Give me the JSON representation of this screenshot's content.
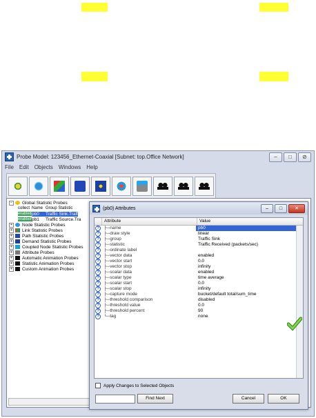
{
  "main_window": {
    "title": "Probe Model: 123456_Ethernet-Coaxial  [Subnet: top.Office Network]",
    "menu": [
      "File",
      "Edit",
      "Objects",
      "Windows",
      "Help"
    ],
    "toolbar_icons": [
      "global-statistic-probe-icon",
      "node-statistic-probe-icon",
      "link-statistic-probe-icon",
      "path-statistic-probe-icon",
      "demand-statistic-probe-icon",
      "coupled-probe-icon",
      "attribute-probe-icon",
      "animation-probe-icon",
      "statistic-animation-icon",
      "custom-animation-icon"
    ]
  },
  "tree": {
    "root": "Global Statistic Probes",
    "header": {
      "collect": "collect",
      "name": "Name",
      "group": "Group Statistic"
    },
    "probes": [
      {
        "collect": "enabled",
        "name": "pb0",
        "group": "Traffic Sink.Traff"
      },
      {
        "collect": "enabled",
        "name": "pb1",
        "group": "Traffic Source.Tra"
      }
    ],
    "categories": [
      "Node Statistic Probes",
      "Link Statistic Probes",
      "Path Statistic Probes",
      "Demand Statistic Probes",
      "Coupled Node Statistic Probes",
      "Attribute Probes",
      "Automatic Animation Probes",
      "Statistic Animation Probes",
      "Custom Animation Probes"
    ]
  },
  "dialog": {
    "title": "(pb0) Attributes",
    "col_attribute": "Attribute",
    "col_value": "Value",
    "rows": [
      {
        "attr": "name",
        "value": "pb0"
      },
      {
        "attr": "draw style",
        "value": "linear"
      },
      {
        "attr": "group",
        "value": "Traffic Sink"
      },
      {
        "attr": "statistic",
        "value": "Traffic Received (packets/sec)"
      },
      {
        "attr": "ordinate label",
        "value": ""
      },
      {
        "attr": "vector data",
        "value": "enabled"
      },
      {
        "attr": "vector start",
        "value": "0.0"
      },
      {
        "attr": "vector stop",
        "value": "infinity"
      },
      {
        "attr": "scalar data",
        "value": "enabled"
      },
      {
        "attr": "scalar type",
        "value": "time average"
      },
      {
        "attr": "scalar start",
        "value": "0.0"
      },
      {
        "attr": "scalar stop",
        "value": "infinity"
      },
      {
        "attr": "capture mode",
        "value": "bucket/default total/sum_time"
      },
      {
        "attr": "threshold comparison",
        "value": "disabled"
      },
      {
        "attr": "threshold value",
        "value": "0.0"
      },
      {
        "attr": "threshold percent",
        "value": "90"
      },
      {
        "attr": "tag",
        "value": "none"
      }
    ],
    "apply_label": "Apply Changes to Selected Objects",
    "find_next": "Find Next",
    "cancel": "Cancel",
    "ok": "OK",
    "accent": "#3165d8"
  }
}
